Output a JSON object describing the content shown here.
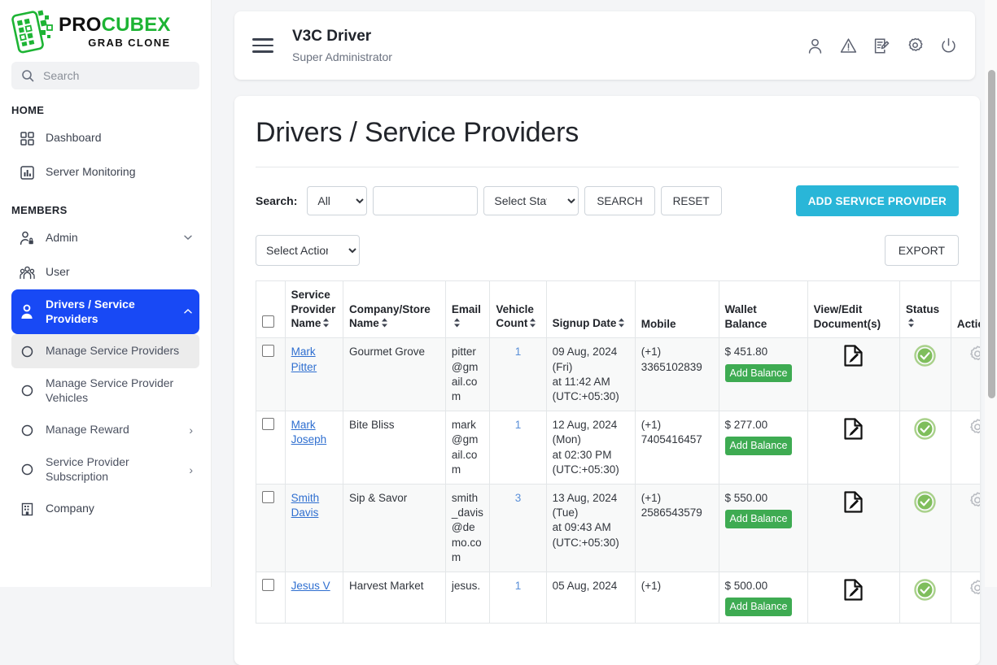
{
  "brand": {
    "name_pro": "PRO",
    "name_cubex": "CUBEX",
    "tagline": "GRAB CLONE"
  },
  "sidebar": {
    "search_placeholder": "Search",
    "sections": [
      {
        "label": "HOME"
      },
      {
        "label": "MEMBERS"
      }
    ],
    "home_items": [
      {
        "label": "Dashboard",
        "icon": "dashboard-icon"
      },
      {
        "label": "Server Monitoring",
        "icon": "chart-icon"
      }
    ],
    "member_items": [
      {
        "label": "Admin",
        "icon": "admin-user-icon",
        "caret": "chevron-down",
        "active": false
      },
      {
        "label": "User",
        "icon": "users-icon",
        "caret": "",
        "active": false
      },
      {
        "label": "Drivers / Service Providers",
        "icon": "driver-icon",
        "caret": "chevron-up",
        "active": true
      }
    ],
    "sub_items": [
      {
        "label": "Manage Service Providers",
        "selected": true,
        "chev": ""
      },
      {
        "label": "Manage Service Provider Vehicles",
        "selected": false,
        "chev": ""
      },
      {
        "label": "Manage Reward",
        "selected": false,
        "chev": "›"
      },
      {
        "label": "Service Provider Subscription",
        "selected": false,
        "chev": "›"
      }
    ],
    "trailing_items": [
      {
        "label": "Company",
        "icon": "building-icon"
      }
    ]
  },
  "header": {
    "menu_icon": "hamburger-icon",
    "title": "V3C Driver",
    "subtitle": "Super Administrator",
    "icons": [
      {
        "name": "profile-icon"
      },
      {
        "name": "alert-icon"
      },
      {
        "name": "notes-icon"
      },
      {
        "name": "gear-icon"
      },
      {
        "name": "power-icon"
      }
    ]
  },
  "page": {
    "title": "Drivers / Service Providers",
    "search_label": "Search:",
    "search_type_value": "All",
    "search_type_options": [
      "All"
    ],
    "search_query_value": "",
    "status_value": "Select Status",
    "status_options": [
      "Select Status"
    ],
    "search_button": "SEARCH",
    "reset_button": "RESET",
    "add_button": "ADD SERVICE PROVIDER",
    "action_value": "Select Action",
    "action_options": [
      "Select Action"
    ],
    "export_button": "EXPORT",
    "accent_primary": "#29b6d8",
    "accent_sidebar_active": "#1849f5",
    "accent_badge_green": "#3eab52",
    "accent_status_green": "#8cc76a"
  },
  "table": {
    "columns": [
      {
        "key": "checkbox",
        "label": "",
        "sortable": false
      },
      {
        "key": "name",
        "label": "Service Provider Name",
        "sortable": true
      },
      {
        "key": "company",
        "label": "Company/Store Name",
        "sortable": true
      },
      {
        "key": "email",
        "label": "Email",
        "sortable": true
      },
      {
        "key": "vehicles",
        "label": "Vehicle Count",
        "sortable": true
      },
      {
        "key": "signup",
        "label": "Signup Date",
        "sortable": true
      },
      {
        "key": "mobile",
        "label": "Mobile",
        "sortable": false
      },
      {
        "key": "wallet",
        "label": "Wallet Balance",
        "sortable": false
      },
      {
        "key": "documents",
        "label": "View/Edit Document(s)",
        "sortable": false
      },
      {
        "key": "status",
        "label": "Status",
        "sortable": true
      },
      {
        "key": "actions",
        "label": "Actio",
        "sortable": false
      }
    ],
    "add_balance_label": "Add Balance",
    "rows": [
      {
        "name": "Mark Pitter",
        "company": "Gourmet Grove",
        "email": "pitter@gmail.com",
        "vehicles": "1",
        "signup_date": "09 Aug, 2024",
        "signup_day": "(Fri)",
        "signup_time": "at 11:42 AM",
        "signup_tz": "(UTC:+05:30)",
        "mobile_code": "(+1)",
        "mobile_number": "3365102839",
        "wallet": "$ 451.80",
        "status": "active"
      },
      {
        "name": "Mark Joseph",
        "company": "Bite Bliss",
        "email": "mark@gmail.com",
        "vehicles": "1",
        "signup_date": "12 Aug, 2024",
        "signup_day": "(Mon)",
        "signup_time": "at 02:30 PM",
        "signup_tz": "(UTC:+05:30)",
        "mobile_code": "(+1)",
        "mobile_number": "7405416457",
        "wallet": "$ 277.00",
        "status": "active"
      },
      {
        "name": "Smith Davis",
        "company": "Sip & Savor",
        "email": "smith_davis@demo.com",
        "vehicles": "3",
        "signup_date": "13 Aug, 2024",
        "signup_day": "(Tue)",
        "signup_time": "at 09:43 AM",
        "signup_tz": "(UTC:+05:30)",
        "mobile_code": "(+1)",
        "mobile_number": "2586543579",
        "wallet": "$ 550.00",
        "status": "active"
      },
      {
        "name": "Jesus V",
        "company": "Harvest Market",
        "email": "jesus.",
        "vehicles": "1",
        "signup_date": "05 Aug, 2024",
        "signup_day": "",
        "signup_time": "",
        "signup_tz": "",
        "mobile_code": "(+1)",
        "mobile_number": "",
        "wallet": "$ 500.00",
        "status": "active"
      }
    ]
  }
}
